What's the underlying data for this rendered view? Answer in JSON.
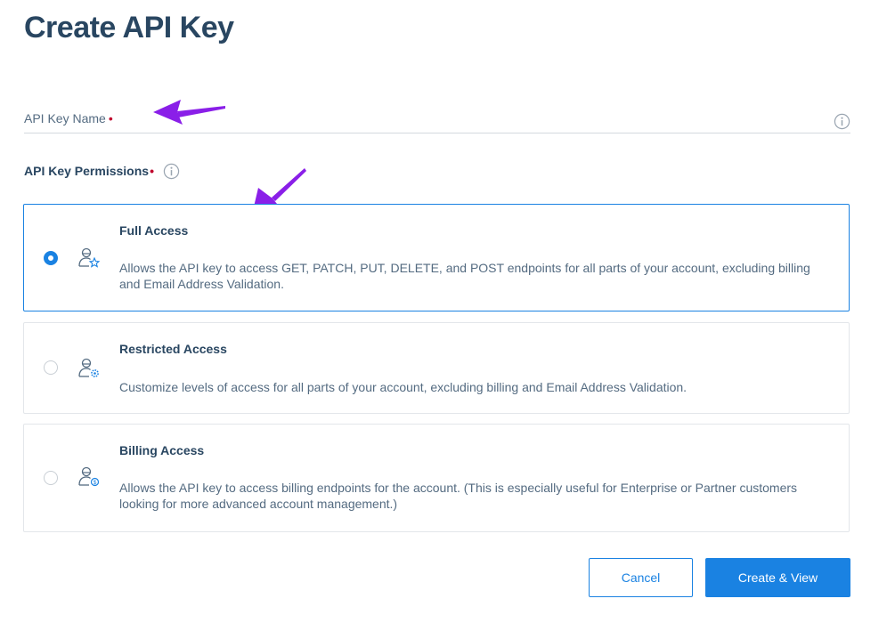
{
  "page": {
    "title": "Create API Key"
  },
  "name_field": {
    "label": "API Key Name",
    "required_mark": "•",
    "value": ""
  },
  "permissions": {
    "label": "API Key Permissions",
    "required_mark": "•",
    "selected": "full-access",
    "options": [
      {
        "id": "full-access",
        "title": "Full Access",
        "description": "Allows the API key to access GET, PATCH, PUT, DELETE, and POST endpoints for all parts of your account, excluding billing and Email Address Validation.",
        "icon": "user-star-icon"
      },
      {
        "id": "restricted-access",
        "title": "Restricted Access",
        "description": "Customize levels of access for all parts of your account, excluding billing and Email Address Validation.",
        "icon": "user-gear-icon"
      },
      {
        "id": "billing-access",
        "title": "Billing Access",
        "description": "Allows the API key to access billing endpoints for the account. (This is especially useful for Enterprise or Partner customers looking for more advanced account management.)",
        "icon": "user-dollar-icon"
      }
    ]
  },
  "actions": {
    "cancel_label": "Cancel",
    "create_label": "Create & View"
  },
  "colors": {
    "primary": "#1a82e2",
    "heading": "#294661",
    "body_text": "#546b81",
    "required": "#c0002c",
    "annotation_arrow": "#8a1fe8"
  }
}
